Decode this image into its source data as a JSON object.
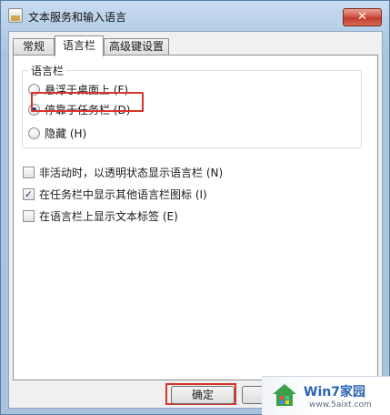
{
  "window": {
    "title": "文本服务和输入语言",
    "close_glyph": "✕"
  },
  "tabs": [
    {
      "label": "常规",
      "active": false
    },
    {
      "label": "语言栏",
      "active": true
    },
    {
      "label": "高级键设置",
      "active": false
    }
  ],
  "langbar_group": {
    "label": "语言栏",
    "options": [
      {
        "label": "悬浮于桌面上 (F)",
        "checked": false
      },
      {
        "label": "停靠于任务栏 (D)",
        "checked": true
      },
      {
        "label": "隐藏 (H)",
        "checked": false
      }
    ]
  },
  "checkboxes": [
    {
      "label": "非活动时，以透明状态显示语言栏 (N)",
      "checked": false
    },
    {
      "label": "在任务栏中显示其他语言栏图标 (I)",
      "checked": true,
      "mark": "✓"
    },
    {
      "label": "在语言栏上显示文本标签 (E)",
      "checked": false
    }
  ],
  "buttons": {
    "ok_label": "确定"
  },
  "watermark": {
    "brand": "Win7家园",
    "site": "www.5aixt.com"
  },
  "colors": {
    "highlight": "#d9342c",
    "close_button": "#c03a2c",
    "watermark_brand": "#2a63b2"
  }
}
